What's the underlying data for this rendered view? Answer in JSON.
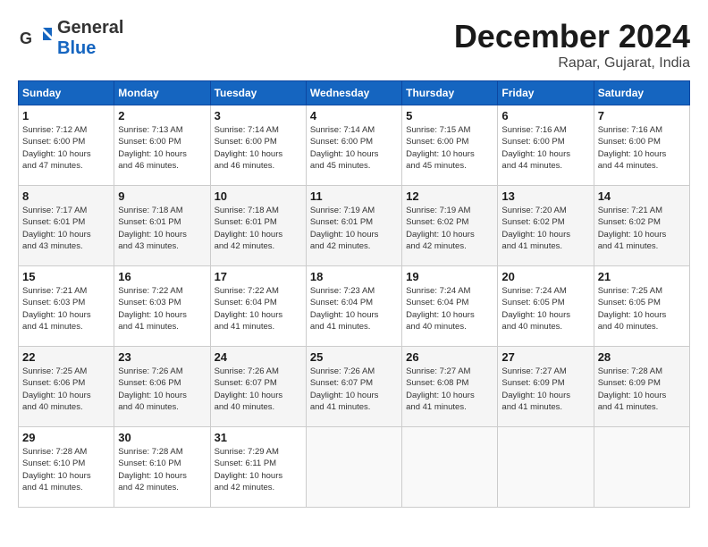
{
  "header": {
    "logo_general": "General",
    "logo_blue": "Blue",
    "month_title": "December 2024",
    "location": "Rapar, Gujarat, India"
  },
  "weekdays": [
    "Sunday",
    "Monday",
    "Tuesday",
    "Wednesday",
    "Thursday",
    "Friday",
    "Saturday"
  ],
  "weeks": [
    [
      {
        "day": "1",
        "info": "Sunrise: 7:12 AM\nSunset: 6:00 PM\nDaylight: 10 hours\nand 47 minutes."
      },
      {
        "day": "2",
        "info": "Sunrise: 7:13 AM\nSunset: 6:00 PM\nDaylight: 10 hours\nand 46 minutes."
      },
      {
        "day": "3",
        "info": "Sunrise: 7:14 AM\nSunset: 6:00 PM\nDaylight: 10 hours\nand 46 minutes."
      },
      {
        "day": "4",
        "info": "Sunrise: 7:14 AM\nSunset: 6:00 PM\nDaylight: 10 hours\nand 45 minutes."
      },
      {
        "day": "5",
        "info": "Sunrise: 7:15 AM\nSunset: 6:00 PM\nDaylight: 10 hours\nand 45 minutes."
      },
      {
        "day": "6",
        "info": "Sunrise: 7:16 AM\nSunset: 6:00 PM\nDaylight: 10 hours\nand 44 minutes."
      },
      {
        "day": "7",
        "info": "Sunrise: 7:16 AM\nSunset: 6:00 PM\nDaylight: 10 hours\nand 44 minutes."
      }
    ],
    [
      {
        "day": "8",
        "info": "Sunrise: 7:17 AM\nSunset: 6:01 PM\nDaylight: 10 hours\nand 43 minutes."
      },
      {
        "day": "9",
        "info": "Sunrise: 7:18 AM\nSunset: 6:01 PM\nDaylight: 10 hours\nand 43 minutes."
      },
      {
        "day": "10",
        "info": "Sunrise: 7:18 AM\nSunset: 6:01 PM\nDaylight: 10 hours\nand 42 minutes."
      },
      {
        "day": "11",
        "info": "Sunrise: 7:19 AM\nSunset: 6:01 PM\nDaylight: 10 hours\nand 42 minutes."
      },
      {
        "day": "12",
        "info": "Sunrise: 7:19 AM\nSunset: 6:02 PM\nDaylight: 10 hours\nand 42 minutes."
      },
      {
        "day": "13",
        "info": "Sunrise: 7:20 AM\nSunset: 6:02 PM\nDaylight: 10 hours\nand 41 minutes."
      },
      {
        "day": "14",
        "info": "Sunrise: 7:21 AM\nSunset: 6:02 PM\nDaylight: 10 hours\nand 41 minutes."
      }
    ],
    [
      {
        "day": "15",
        "info": "Sunrise: 7:21 AM\nSunset: 6:03 PM\nDaylight: 10 hours\nand 41 minutes."
      },
      {
        "day": "16",
        "info": "Sunrise: 7:22 AM\nSunset: 6:03 PM\nDaylight: 10 hours\nand 41 minutes."
      },
      {
        "day": "17",
        "info": "Sunrise: 7:22 AM\nSunset: 6:04 PM\nDaylight: 10 hours\nand 41 minutes."
      },
      {
        "day": "18",
        "info": "Sunrise: 7:23 AM\nSunset: 6:04 PM\nDaylight: 10 hours\nand 41 minutes."
      },
      {
        "day": "19",
        "info": "Sunrise: 7:24 AM\nSunset: 6:04 PM\nDaylight: 10 hours\nand 40 minutes."
      },
      {
        "day": "20",
        "info": "Sunrise: 7:24 AM\nSunset: 6:05 PM\nDaylight: 10 hours\nand 40 minutes."
      },
      {
        "day": "21",
        "info": "Sunrise: 7:25 AM\nSunset: 6:05 PM\nDaylight: 10 hours\nand 40 minutes."
      }
    ],
    [
      {
        "day": "22",
        "info": "Sunrise: 7:25 AM\nSunset: 6:06 PM\nDaylight: 10 hours\nand 40 minutes."
      },
      {
        "day": "23",
        "info": "Sunrise: 7:26 AM\nSunset: 6:06 PM\nDaylight: 10 hours\nand 40 minutes."
      },
      {
        "day": "24",
        "info": "Sunrise: 7:26 AM\nSunset: 6:07 PM\nDaylight: 10 hours\nand 40 minutes."
      },
      {
        "day": "25",
        "info": "Sunrise: 7:26 AM\nSunset: 6:07 PM\nDaylight: 10 hours\nand 41 minutes."
      },
      {
        "day": "26",
        "info": "Sunrise: 7:27 AM\nSunset: 6:08 PM\nDaylight: 10 hours\nand 41 minutes."
      },
      {
        "day": "27",
        "info": "Sunrise: 7:27 AM\nSunset: 6:09 PM\nDaylight: 10 hours\nand 41 minutes."
      },
      {
        "day": "28",
        "info": "Sunrise: 7:28 AM\nSunset: 6:09 PM\nDaylight: 10 hours\nand 41 minutes."
      }
    ],
    [
      {
        "day": "29",
        "info": "Sunrise: 7:28 AM\nSunset: 6:10 PM\nDaylight: 10 hours\nand 41 minutes."
      },
      {
        "day": "30",
        "info": "Sunrise: 7:28 AM\nSunset: 6:10 PM\nDaylight: 10 hours\nand 42 minutes."
      },
      {
        "day": "31",
        "info": "Sunrise: 7:29 AM\nSunset: 6:11 PM\nDaylight: 10 hours\nand 42 minutes."
      },
      {
        "day": "",
        "info": ""
      },
      {
        "day": "",
        "info": ""
      },
      {
        "day": "",
        "info": ""
      },
      {
        "day": "",
        "info": ""
      }
    ]
  ]
}
